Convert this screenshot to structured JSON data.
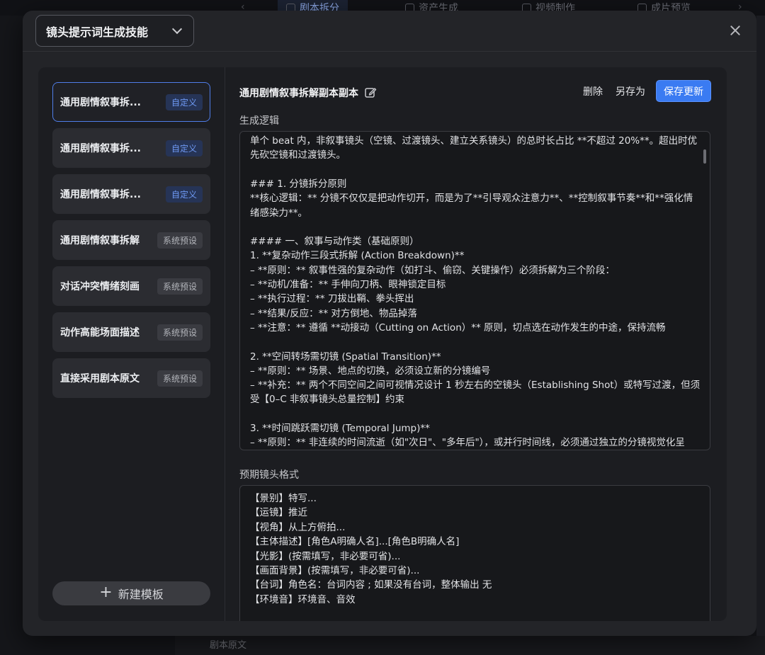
{
  "background": {
    "tabs": [
      {
        "label": "剧本拆分",
        "active": true
      },
      {
        "label": "资产生成",
        "active": false
      },
      {
        "label": "视频制作",
        "active": false
      },
      {
        "label": "成片预览",
        "active": false
      }
    ],
    "bottom_label": "剧本原文"
  },
  "modal": {
    "skill_select": "镜头提示词生成技能",
    "sidebar": {
      "templates": [
        {
          "name": "通用剧情叙事拆...",
          "badge": "自定义",
          "badge_type": "custom",
          "selected": true
        },
        {
          "name": "通用剧情叙事拆...",
          "badge": "自定义",
          "badge_type": "custom",
          "selected": false
        },
        {
          "name": "通用剧情叙事拆...",
          "badge": "自定义",
          "badge_type": "custom",
          "selected": false
        },
        {
          "name": "通用剧情叙事拆解",
          "badge": "系统预设",
          "badge_type": "preset",
          "selected": false
        },
        {
          "name": "对话冲突情绪刻画",
          "badge": "系统预设",
          "badge_type": "preset",
          "selected": false
        },
        {
          "name": "动作高能场面描述",
          "badge": "系统预设",
          "badge_type": "preset",
          "selected": false
        },
        {
          "name": "直接采用剧本原文",
          "badge": "系统预设",
          "badge_type": "preset",
          "selected": false
        }
      ],
      "new_template": "新建模板"
    },
    "editor": {
      "title": "通用剧情叙事拆解副本副本",
      "delete": "删除",
      "save_as": "另存为",
      "save_update": "保存更新",
      "logic_label": "生成逻辑",
      "logic_lines": [
        "单个 beat 内，非叙事镜头（空镜、过渡镜头、建立关系镜头）的总时长占比 **不超过 20%**。超出时优",
        "先砍空镜和过渡镜头。",
        "",
        "### 1. 分镜拆分原则",
        "**核心逻辑：** 分镜不仅仅是把动作切开，而是为了**引导观众注意力**、**控制叙事节奏**和**强化情",
        "绪感染力**。",
        "",
        "#### 一、叙事与动作类（基础原则）",
        "1. **复杂动作三段式拆解 (Action Breakdown)**",
        "   – **原则：** 叙事性强的复杂动作（如打斗、偷窃、关键操作）必须拆解为三个阶段：",
        "     – **动机/准备：** 手伸向刀柄、眼神锁定目标",
        "     – **执行过程：** 刀拔出鞘、拳头挥出",
        "     – **结果/反应：** 对方倒地、物品掉落",
        "   – **注意：** 遵循 **动接动（Cutting on Action）** 原则，切点选在动作发生的中途，保持流畅",
        "",
        "2. **空间转场需切镜 (Spatial Transition)**",
        "   – **原则：** 场景、地点的切换，必须设立新的分镜编号",
        "   – **补充：** 两个不同空间之间可视情况设计 1 秒左右的空镜头（Establishing Shot）或特写过渡，但须",
        "受【0–C 非叙事镜头总量控制】约束",
        "",
        "3. **时间跳跃需切镜 (Temporal Jump)**",
        "   – **原则：** 非连续的时间流逝（如\"次日\"、\"多年后\"），或并行时间线，必须通过独立的分镜视觉化呈"
      ],
      "format_label": "预期镜头格式",
      "format_lines": [
        "【景别】特写...",
        "【运镜】推近",
        "【视角】从上方俯拍...",
        "【主体描述】[角色A明确人名]...[角色B明确人名]",
        "【光影】(按需填写，非必要可省)...",
        "【画面背景】(按需填写，非必要可省)...",
        "【台词】角色名：台词内容 ; 如果没有台词，整体输出 无",
        "【环境音】环境音、音效"
      ]
    }
  },
  "colors": {
    "accent": "#3a7bf2",
    "selected_border": "#4f7de8",
    "custom_badge_bg": "#263456",
    "custom_badge_fg": "#6f9af5",
    "preset_badge_bg": "#3a3b41"
  }
}
